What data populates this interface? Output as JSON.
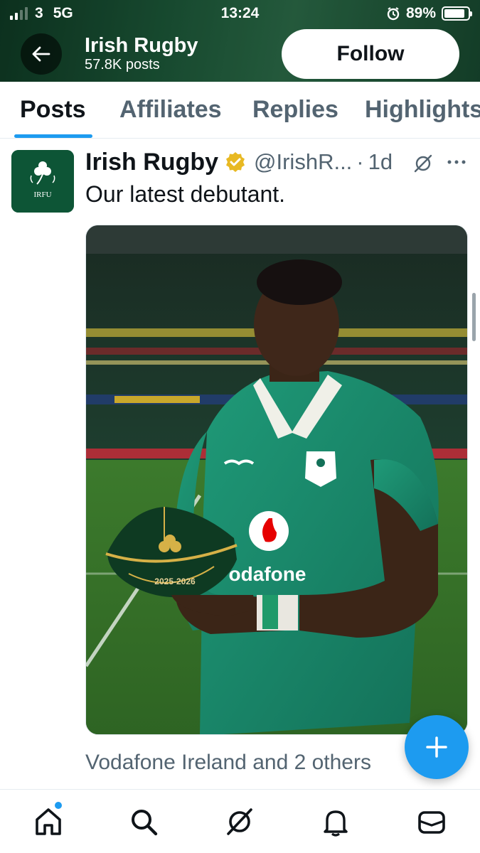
{
  "status_bar": {
    "carrier": "3",
    "network": "5G",
    "time": "13:24",
    "battery": "89%"
  },
  "profile": {
    "name": "Irish Rugby",
    "posts_count": "57.8K posts",
    "follow_label": "Follow"
  },
  "tabs": [
    {
      "label": "Posts"
    },
    {
      "label": "Affiliates"
    },
    {
      "label": "Replies"
    },
    {
      "label": "Highlights"
    }
  ],
  "post": {
    "author": "Irish Rugby",
    "handle": "@IrishR...",
    "separator": "·",
    "time": "1d",
    "text": "Our latest debutant.",
    "avatar_text": "IRFU",
    "liked_by": "Vodafone Ireland and 2 others",
    "media": {
      "sponsor": "odafone",
      "cap_years": "2025-2026",
      "jersey_badge": "IRFU"
    }
  },
  "colors": {
    "accent": "#1d9bf0",
    "header_green": "#1d5a3a",
    "verified_gold": "#e8b923",
    "jersey_green": "#1a8a6a"
  },
  "icons": [
    "back-arrow-icon",
    "verified-badge-icon",
    "grok-icon",
    "more-icon",
    "compose-plus-icon",
    "home-icon",
    "search-icon",
    "grok-nav-icon",
    "bell-icon",
    "mail-icon"
  ]
}
